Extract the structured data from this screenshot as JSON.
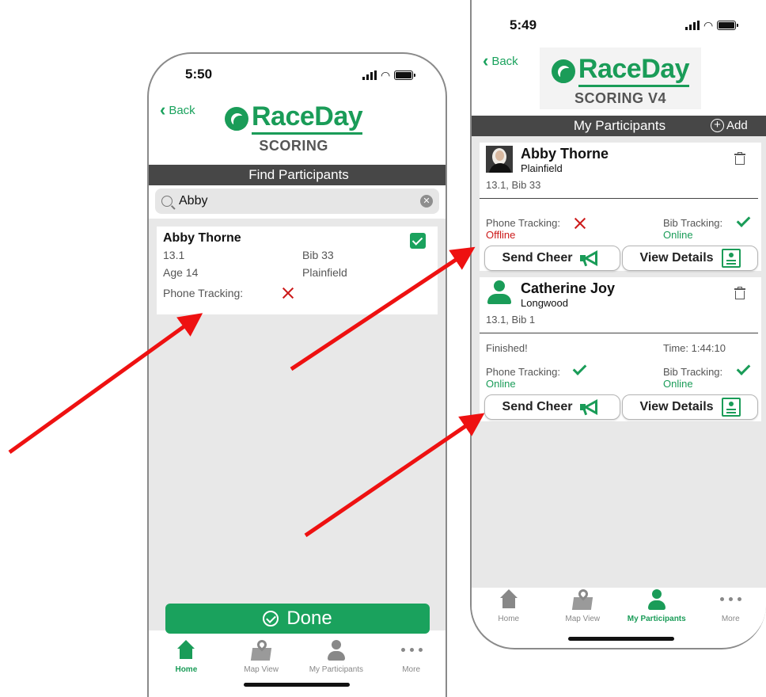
{
  "left": {
    "status": {
      "time": "5:50"
    },
    "back_label": "Back",
    "logo": {
      "text": "RaceDay",
      "sub": "SCORING"
    },
    "section_title": "Find Participants",
    "search": {
      "value": "Abby"
    },
    "result": {
      "name": "Abby Thorne",
      "distance": "13.1",
      "bib": "Bib 33",
      "age": "Age 14",
      "location": "Plainfield",
      "phone_tracking_label": "Phone Tracking:"
    },
    "done_label": "Done",
    "tabs": [
      {
        "label": "Home"
      },
      {
        "label": "Map View"
      },
      {
        "label": "My Participants"
      },
      {
        "label": "More"
      }
    ],
    "active_tab": "Home"
  },
  "right": {
    "status": {
      "time": "5:49"
    },
    "back_label": "Back",
    "logo": {
      "text": "RaceDay",
      "sub": "SCORING V4"
    },
    "section_title": "My Participants",
    "add_label": "Add",
    "participants": [
      {
        "name": "Abby Thorne",
        "location": "Plainfield",
        "race_info": "13.1, Bib 33",
        "phone_label": "Phone Tracking:",
        "phone_status": "Offline",
        "bib_label": "Bib Tracking:",
        "bib_status": "Online",
        "cheer_label": "Send Cheer",
        "details_label": "View Details"
      },
      {
        "name": "Catherine Joy",
        "location": "Longwood",
        "race_info": "13.1, Bib 1",
        "finished_label": "Finished!",
        "time_label": "Time: 1:44:10",
        "phone_label": "Phone Tracking:",
        "phone_status": "Online",
        "bib_label": "Bib Tracking:",
        "bib_status": "Online",
        "cheer_label": "Send Cheer",
        "details_label": "View Details"
      }
    ],
    "tabs": [
      {
        "label": "Home"
      },
      {
        "label": "Map View"
      },
      {
        "label": "My Participants"
      },
      {
        "label": "More"
      }
    ],
    "active_tab": "My Participants"
  },
  "colors": {
    "brand_green": "#1a9c58",
    "header_gray": "#474747",
    "error_red": "#cc1a1a",
    "annotation_arrow": "#ee1111"
  }
}
